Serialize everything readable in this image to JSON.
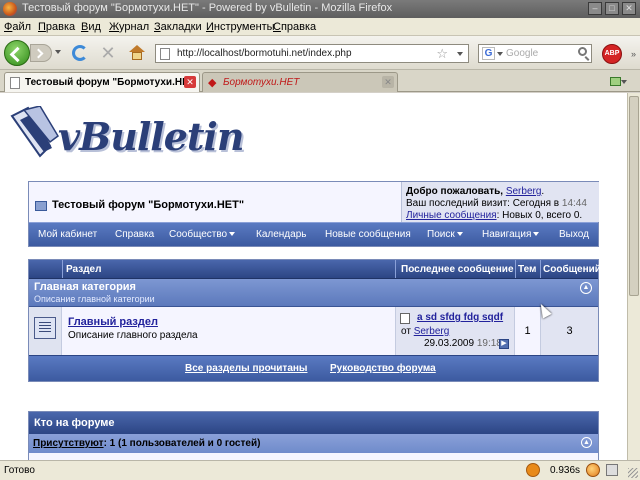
{
  "window": {
    "title": "Тестовый форум \"Бормотухи.НЕТ\" - Powered by vBulletin - Mozilla Firefox"
  },
  "menubar": {
    "items": [
      {
        "pre": "",
        "u": "Ф",
        "post": "айл"
      },
      {
        "pre": "",
        "u": "П",
        "post": "равка"
      },
      {
        "pre": "",
        "u": "В",
        "post": "ид"
      },
      {
        "pre": "",
        "u": "Ж",
        "post": "урнал"
      },
      {
        "pre": "",
        "u": "З",
        "post": "акладки"
      },
      {
        "pre": "",
        "u": "И",
        "post": "нструменты"
      },
      {
        "pre": "",
        "u": "С",
        "post": "правка"
      }
    ]
  },
  "navbar": {
    "url": "http://localhost/bormotuhi.net/index.php",
    "search_placeholder": "Google",
    "search_engine_letter": "G",
    "adblock_label": "ABP"
  },
  "tabs": [
    {
      "label": "Тестовый форум \"Бормотухи.НЕТ\"",
      "active": true
    },
    {
      "label": "Бормотухи.НЕТ",
      "active": false
    }
  ],
  "forum": {
    "logo_text": "vBulletin",
    "title": "Тестовый форум \"Бормотухи.НЕТ\"",
    "welcome": {
      "greeting": "Добро пожаловать,",
      "username": "Serberg",
      "greeting_end": ".",
      "last_visit_label": "Ваш последний визит: Сегодня в",
      "last_visit_time": "14:44",
      "pm_link": "Личные сообщения",
      "pm_stats": ": Новых 0, всего 0."
    },
    "menu": [
      {
        "label": "Мой кабинет",
        "dropdown": false
      },
      {
        "label": "Справка",
        "dropdown": false
      },
      {
        "label": "Сообщество",
        "dropdown": true
      },
      {
        "label": "Календарь",
        "dropdown": false
      },
      {
        "label": "Новые сообщения",
        "dropdown": false
      },
      {
        "label": "Поиск",
        "dropdown": true
      },
      {
        "label": "Навигация",
        "dropdown": true
      },
      {
        "label": "Выход",
        "dropdown": false
      }
    ],
    "table": {
      "headers": {
        "section": "Раздел",
        "last_post": "Последнее сообщение",
        "threads": "Тем",
        "posts": "Сообщений"
      },
      "category": {
        "title": "Главная категория",
        "description": "Описание главной категории"
      },
      "forums": [
        {
          "name": "Главный раздел",
          "description": "Описание главного раздела",
          "last_post_title": "a sd sfdg fdg sqdf",
          "last_post_from": "от",
          "last_post_author": "Serberg",
          "last_post_date": "29.03.2009",
          "last_post_time": "19:18",
          "threads": "1",
          "posts": "3"
        }
      ],
      "footer_links": {
        "mark_read": "Все разделы прочитаны",
        "guide": "Руководство форума"
      }
    },
    "whos_online": {
      "title": "Кто на форуме",
      "present_label": "Присутствуют",
      "present_stats": ": 1 (1 пользователей и 0 гостей)"
    }
  },
  "statusbar": {
    "text": "Готово",
    "timing": "0.936s"
  },
  "colors": {
    "vb_header_dark": "#2c4584",
    "vb_header_light": "#5a7ac2",
    "vb_link": "#22229c",
    "vb_alt_bg": "#f5f5ff"
  }
}
